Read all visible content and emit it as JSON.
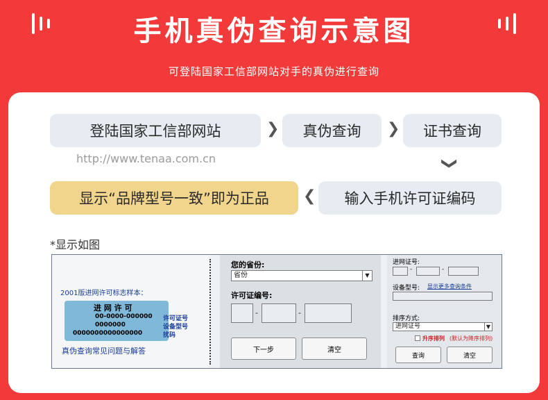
{
  "header": {
    "title": "手机真伪查询示意图",
    "subtitle": "可登陆国家工信部网站对手的真伪进行查询"
  },
  "steps": {
    "step1": "登陆国家工信部网站",
    "step2": "真伪查询",
    "step3": "证书查询",
    "step4": "输入手机许可证编码",
    "step5": "显示“品牌型号一致”即为正品",
    "url": "http://www.tenaa.com.cn",
    "note": "*显示如图"
  },
  "screenshot": {
    "left": {
      "sample_title": "2001版进网许可标志样本：",
      "card_title": "进 网 许 可",
      "line1": "00-0000-000000",
      "line2": "0000000",
      "line3": "0000000000000000",
      "label1": "许可证号",
      "label2": "设备型号",
      "label3": "扰码",
      "faq": "真伪查询常见问题与解答"
    },
    "middle": {
      "province_label": "您的省份:",
      "province_value": "省份",
      "license_label": "许可证编号:",
      "dash": "-",
      "next_button": "下一步",
      "clear_button": "清空"
    },
    "right": {
      "network_label": "进网证号:",
      "dash": "-",
      "model_label": "设备型号:",
      "model_link": "显示更多查询条件",
      "sort_label": "排序方式:",
      "sort_value": "进网证号",
      "asc_label": "升序排列",
      "asc_note": "(默认为降序排列)",
      "query_button": "查询",
      "clear_button": "清空"
    }
  },
  "colors": {
    "brand_red": "#f23a3a",
    "step_bg": "#e6ecf2",
    "step_highlight": "#f1d58d"
  }
}
